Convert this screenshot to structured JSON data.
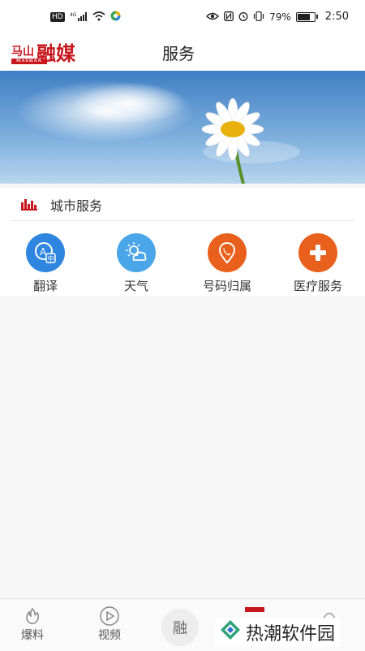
{
  "status_bar": {
    "network_chip": "HD",
    "signal_label": "4G",
    "battery_percent": "79%",
    "battery_level": 0.79,
    "time": "2:50"
  },
  "header": {
    "logo_small": "马山",
    "logo_small_sub": "MASHAN",
    "logo_big": "融媒",
    "title": "服务"
  },
  "section": {
    "title": "城市服务"
  },
  "services": [
    {
      "label": "翻译",
      "icon": "translate-icon",
      "color": "#2f86e0"
    },
    {
      "label": "天气",
      "icon": "weather-icon",
      "color": "#4aa6e8"
    },
    {
      "label": "号码归属",
      "icon": "phone-location-icon",
      "color": "#e8601c"
    },
    {
      "label": "医疗服务",
      "icon": "medical-plus-icon",
      "color": "#e8601c"
    }
  ],
  "bottom_nav": {
    "items": [
      {
        "label": "爆料",
        "icon": "flame-icon"
      },
      {
        "label": "视频",
        "icon": "play-icon"
      }
    ],
    "center_label": "融",
    "accent_color": "#c8161d"
  },
  "watermark": {
    "text": "热潮软件园"
  }
}
